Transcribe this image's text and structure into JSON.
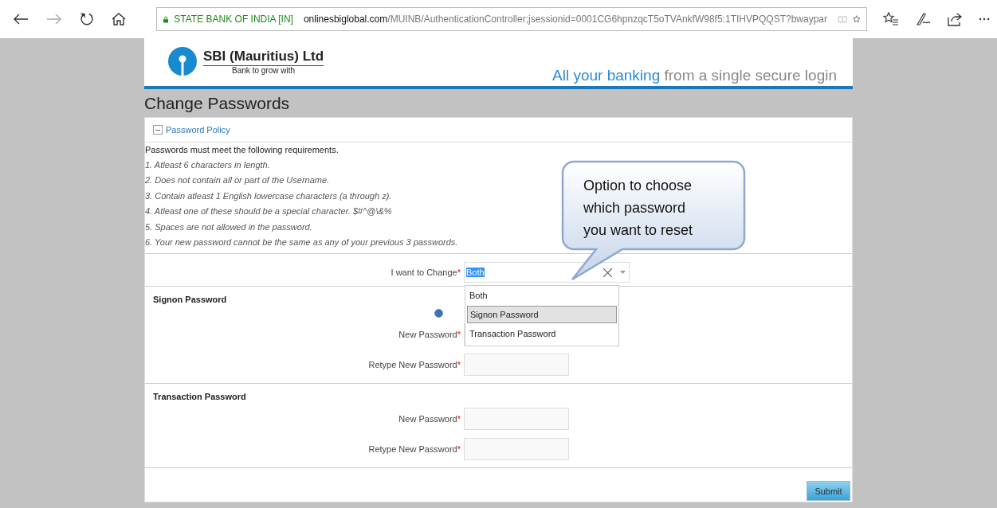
{
  "browser": {
    "secure_label": "STATE BANK OF INDIA [IN]",
    "host": "onlinesbiglobal.com",
    "path": "/MUINB/AuthenticationController;jsessionid=0001CG6hpnzqcT5oTVAnkfW98f5:1TIHVPQQST?bwaypar"
  },
  "header": {
    "brand": "SBI (Mauritius) Ltd",
    "tagline": "Bank to grow with",
    "slogan_highlight": "All your banking",
    "slogan_rest": "from a single secure login"
  },
  "page_title": "Change Passwords",
  "policy": {
    "title": "Password Policy",
    "expanded": true,
    "intro": "Passwords must meet the following requirements.",
    "rules": [
      "1. Atleast 6 characters in length.",
      "2. Does not contain all or part of the Username.",
      "3. Contain atleast 1 English lowercase characters (a through z).",
      "4. Atleast one of these should be a special character. $#^@\\&%",
      "5. Spaces are not allowed in the password.",
      "6. Your new password cannot be the same as any of your previous 3 passwords."
    ]
  },
  "required_mark": "*",
  "change_select": {
    "label": "I want to Change",
    "required": true,
    "value": "Both",
    "open": true,
    "options": [
      {
        "label": "Both",
        "highlighted": false
      },
      {
        "label": "Signon Password",
        "highlighted": true
      },
      {
        "label": "Transaction Password",
        "highlighted": false
      }
    ]
  },
  "sections": [
    {
      "title": "Signon Password",
      "fields": [
        {
          "label": "New Password",
          "required": true
        },
        {
          "label": "Retype New Password",
          "required": true
        }
      ]
    },
    {
      "title": "Transaction Password",
      "fields": [
        {
          "label": "New Password",
          "required": true
        },
        {
          "label": "Retype New Password",
          "required": true
        }
      ]
    }
  ],
  "submit": "Submit",
  "callout": "Option to choose which password you want to reset"
}
